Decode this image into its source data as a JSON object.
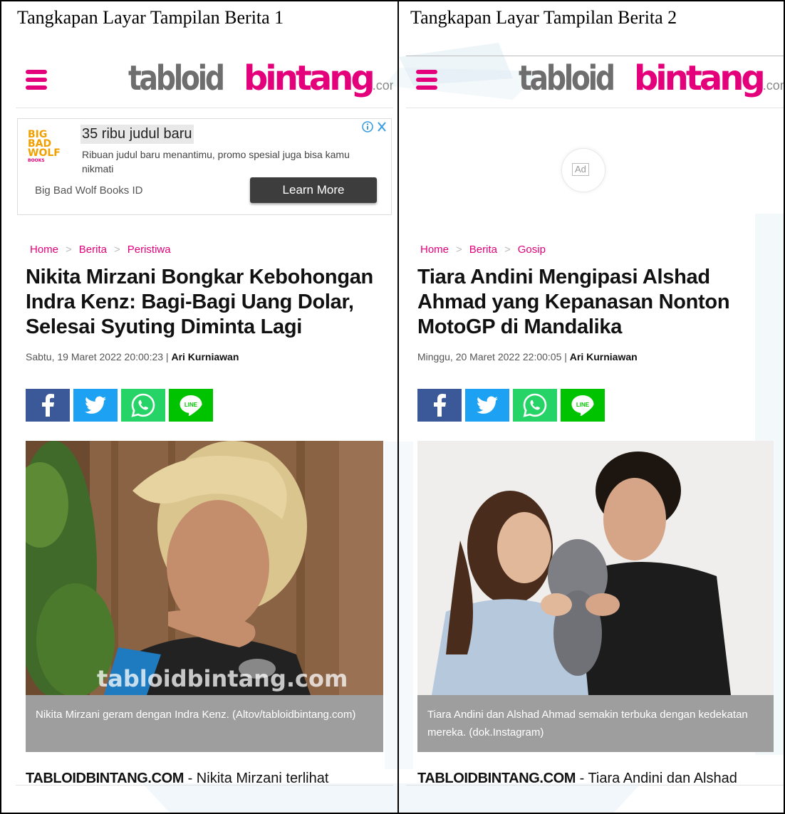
{
  "columns": [
    {
      "title": "Tangkapan Layar Tampilan Berita 1",
      "site": {
        "logo_part1": "tabloid",
        "logo_part2": "bintang",
        "logo_suffix": ".com"
      },
      "ad": {
        "title": "35 ribu judul baru",
        "description": "Ribuan judul baru menantimu, promo spesial juga bisa kamu nikmati",
        "advertiser": "Big Bad Wolf Books ID",
        "button": "Learn More",
        "brand_line1": "BIG",
        "brand_line2": "BAD",
        "brand_line3": "WOLF",
        "brand_line4": "BOOKS"
      },
      "breadcrumb": [
        "Home",
        "Berita",
        "Peristiwa"
      ],
      "headline": "Nikita Mirzani Bongkar Kebohongan Indra Kenz: Bagi-Bagi Uang Dolar, Selesai Syuting Diminta Lagi",
      "date": "Sabtu, 19 Maret 2022 20:00:23",
      "author": "Ari Kurniawan",
      "photo_watermark": "tabloidbintang.com",
      "caption": "Nikita Mirzani geram dengan Indra Kenz. (Altov/tabloidbintang.com)",
      "lead_source": "TABLOIDBINTANG.COM",
      "lead_text": " - Nikita Mirzani terlihat"
    },
    {
      "title": "Tangkapan Layar Tampilan Berita 2",
      "site": {
        "logo_part1": "tabloid",
        "logo_part2": "bintang",
        "logo_suffix": ".com"
      },
      "ad": {
        "placeholder": "Ad"
      },
      "breadcrumb": [
        "Home",
        "Berita",
        "Gosip"
      ],
      "headline": "Tiara Andini Mengipasi Alshad Ahmad yang Kepanasan Nonton MotoGP di Mandalika",
      "date": "Minggu, 20 Maret 2022 22:00:05",
      "author": "Ari Kurniawan",
      "caption": "Tiara Andini dan Alshad Ahmad semakin terbuka dengan kedekatan mereka. (dok.Instagram)",
      "lead_source": "TABLOIDBINTANG.COM",
      "lead_text": " - Tiara Andini dan Alshad"
    }
  ],
  "share_buttons": [
    "facebook",
    "twitter",
    "whatsapp",
    "line"
  ],
  "share_line_label": "LINE",
  "ad_choices_icons": [
    "info-icon",
    "close-icon"
  ],
  "colors": {
    "brand_pink": "#e4007a",
    "logo_grey": "#6e6e6e",
    "facebook": "#3b5998",
    "twitter": "#1da1f2",
    "whatsapp": "#25d366",
    "line": "#00c300",
    "caption_bg": "#9e9e9e",
    "ad_button_bg": "#3d3d3d"
  }
}
